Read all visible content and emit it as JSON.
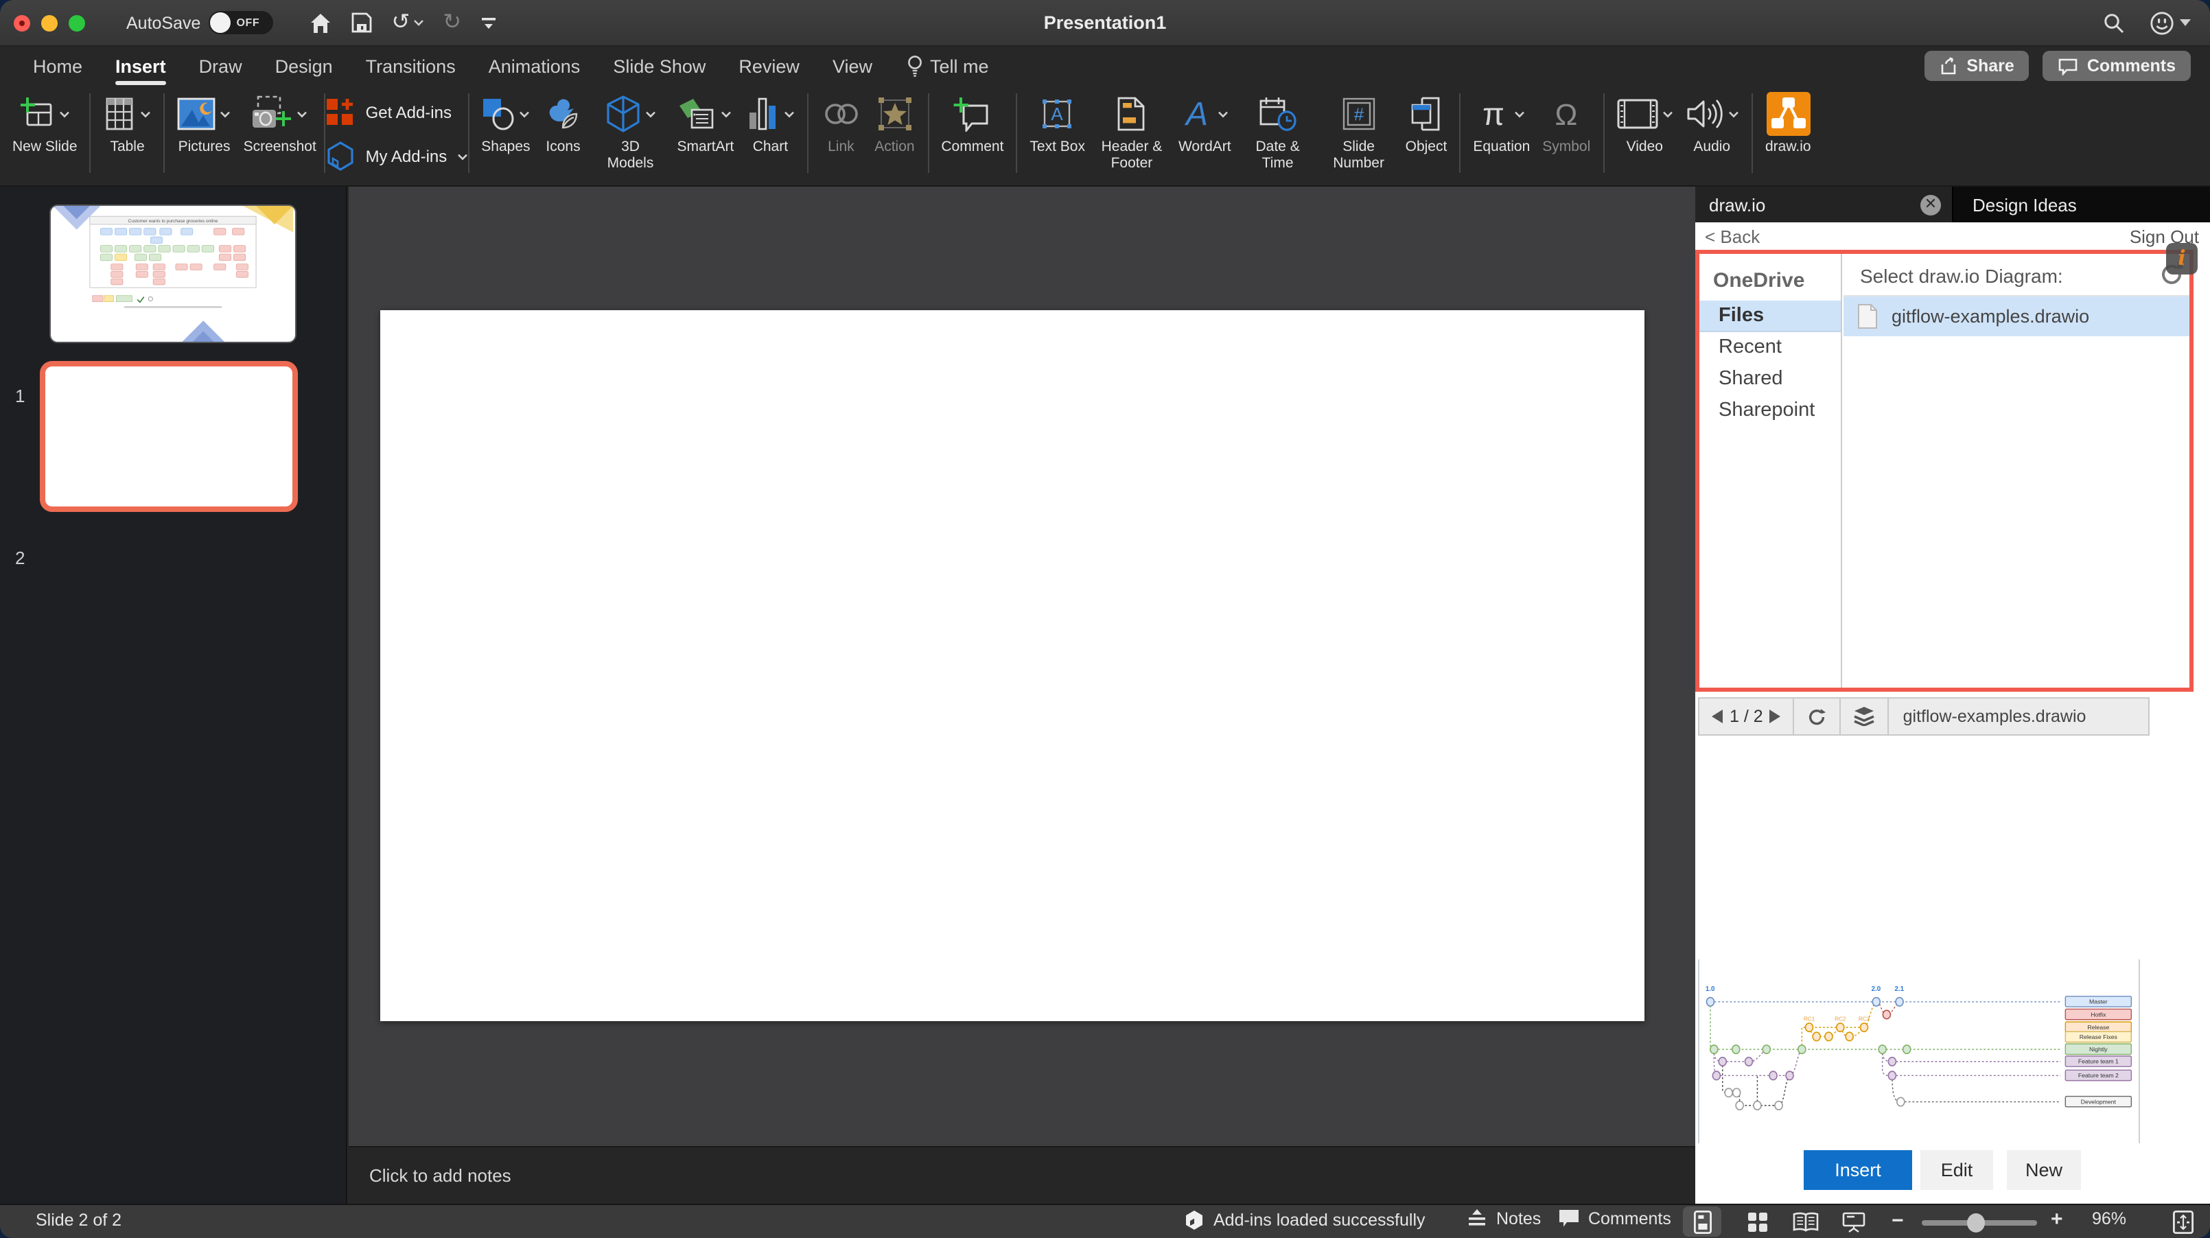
{
  "titlebar": {
    "autosave_label": "AutoSave",
    "autosave_state": "OFF",
    "title": "Presentation1"
  },
  "tabs": {
    "items": [
      {
        "label": "Home"
      },
      {
        "label": "Insert",
        "active": true
      },
      {
        "label": "Draw"
      },
      {
        "label": "Design"
      },
      {
        "label": "Transitions"
      },
      {
        "label": "Animations"
      },
      {
        "label": "Slide Show"
      },
      {
        "label": "Review"
      },
      {
        "label": "View"
      },
      {
        "label": "Tell me",
        "icon": "lightbulb"
      }
    ],
    "share_label": "Share",
    "comments_label": "Comments"
  },
  "ribbon": {
    "groups": [
      {
        "items": [
          {
            "id": "new-slide",
            "label": "New Slide",
            "chevron": true
          }
        ]
      },
      {
        "items": [
          {
            "id": "table",
            "label": "Table",
            "chevron": true
          }
        ]
      },
      {
        "items": [
          {
            "id": "pictures",
            "label": "Pictures",
            "chevron": true
          },
          {
            "id": "screenshot",
            "label": "Screenshot",
            "chevron": true
          }
        ]
      },
      {
        "stacked": true,
        "items": [
          {
            "id": "get-addins",
            "label": "Get Add-ins"
          },
          {
            "id": "my-addins",
            "label": "My Add-ins",
            "chevron": true
          }
        ]
      },
      {
        "items": [
          {
            "id": "shapes",
            "label": "Shapes",
            "chevron": true
          },
          {
            "id": "icons",
            "label": "Icons"
          },
          {
            "id": "3d-models",
            "label": "3D Models",
            "chevron": true
          },
          {
            "id": "smartart",
            "label": "SmartArt",
            "chevron": true
          },
          {
            "id": "chart",
            "label": "Chart",
            "chevron": true
          }
        ]
      },
      {
        "items": [
          {
            "id": "link",
            "label": "Link",
            "disabled": true
          },
          {
            "id": "action",
            "label": "Action",
            "disabled": true
          }
        ]
      },
      {
        "items": [
          {
            "id": "comment",
            "label": "Comment"
          }
        ]
      },
      {
        "items": [
          {
            "id": "text-box",
            "label": "Text Box"
          },
          {
            "id": "header-footer",
            "label": "Header & Footer"
          },
          {
            "id": "wordart",
            "label": "WordArt",
            "chevron": true
          },
          {
            "id": "date-time",
            "label": "Date & Time"
          },
          {
            "id": "slide-number",
            "label": "Slide Number"
          },
          {
            "id": "object",
            "label": "Object"
          }
        ]
      },
      {
        "items": [
          {
            "id": "equation",
            "label": "Equation",
            "chevron": true
          },
          {
            "id": "symbol",
            "label": "Symbol",
            "disabled": true
          }
        ]
      },
      {
        "items": [
          {
            "id": "video",
            "label": "Video",
            "chevron": true
          },
          {
            "id": "audio",
            "label": "Audio",
            "chevron": true
          }
        ]
      },
      {
        "items": [
          {
            "id": "drawio",
            "label": "draw.io"
          }
        ]
      }
    ]
  },
  "sidebar": {
    "slides": [
      {
        "number": "1",
        "title": "Customer wants to purchase groceries online"
      },
      {
        "number": "2",
        "selected": true
      }
    ]
  },
  "canvas": {
    "notes_placeholder": "Click to add notes"
  },
  "statusbar": {
    "slide_indicator": "Slide 2 of 2",
    "addins_status": "Add-ins loaded successfully",
    "notes_label": "Notes",
    "comments_label": "Comments",
    "zoom_level": "96%"
  },
  "panel": {
    "tab_drawio": "draw.io",
    "tab_design_ideas": "Design Ideas",
    "back_label": "< Back",
    "signout_label": "Sign Out",
    "source_header": "OneDrive",
    "sources": [
      {
        "label": "Files",
        "selected": true
      },
      {
        "label": "Recent"
      },
      {
        "label": "Shared"
      },
      {
        "label": "Sharepoint"
      }
    ],
    "select_label": "Select draw.io Diagram:",
    "file_name": "gitflow-examples.drawio",
    "pager": {
      "page_indicator": "1 / 2",
      "file_name": "gitflow-examples.drawio"
    },
    "buttons": {
      "insert": "Insert",
      "edit": "Edit",
      "new": "New"
    },
    "accent_colors": {
      "selection_blue": "#cfe3f8",
      "highlight_red": "#f05a4d",
      "insert_blue": "#1070c9"
    },
    "preview": {
      "tags": [
        "1.0",
        "2.0",
        "2.1"
      ],
      "rc_labels": [
        "RC1",
        "RC2",
        "RC3"
      ],
      "branches": [
        {
          "name": "Master",
          "color": "#6c8ebf",
          "fill": "#dae8fc"
        },
        {
          "name": "Hotfix",
          "color": "#b85450",
          "fill": "#f8cecc"
        },
        {
          "name": "Release",
          "color": "#d79b00",
          "fill": "#ffe6cc"
        },
        {
          "name": "Release Fixes",
          "color": "#d6b656",
          "fill": "#fff2cc"
        },
        {
          "name": "Nightly",
          "color": "#82b366",
          "fill": "#d5e8d4"
        },
        {
          "name": "Feature team 1",
          "color": "#9673a6",
          "fill": "#e1d5e7"
        },
        {
          "name": "Feature team 2",
          "color": "#9673a6",
          "fill": "#e1d5e7"
        },
        {
          "name": "Development",
          "color": "#666666",
          "fill": "#f5f5f5"
        }
      ]
    }
  }
}
